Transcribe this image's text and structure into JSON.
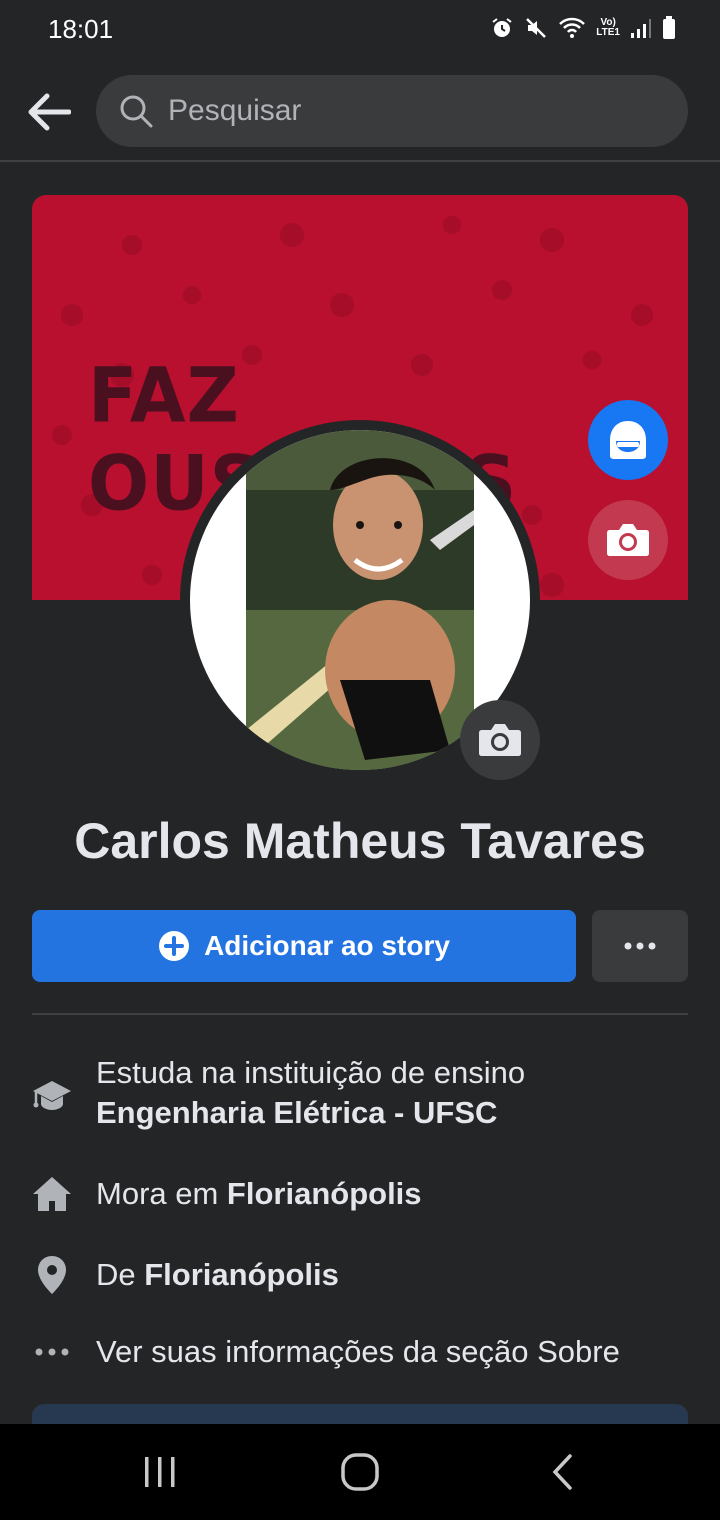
{
  "status": {
    "time": "18:01",
    "network": "LTE1"
  },
  "search": {
    "placeholder": "Pesquisar"
  },
  "cover": {
    "text": "FAZ OUSADIAS",
    "color": "#b8102e"
  },
  "profile": {
    "name": "Carlos Matheus Tavares"
  },
  "actions": {
    "story_label": "Adicionar ao story",
    "more_label": "•••"
  },
  "info": {
    "study_prefix": "Estuda na instituição de ensino",
    "study_value": "Engenharia Elétrica - UFSC",
    "lives_prefix": "Mora em ",
    "lives_value": "Florianópolis",
    "from_prefix": "De ",
    "from_value": "Florianópolis",
    "about_label": "Ver suas informações da seção Sobre"
  },
  "icons": {
    "back": "arrow-left-icon",
    "search": "search-icon",
    "avatar": "avatar-icon",
    "camera": "camera-icon",
    "plus": "plus-circle-icon",
    "more": "more-icon",
    "education": "graduation-cap-icon",
    "home": "home-icon",
    "location": "location-pin-icon",
    "about": "ellipsis-icon"
  },
  "colors": {
    "accent": "#2374e1",
    "background": "#242526",
    "cover": "#b8102e"
  }
}
